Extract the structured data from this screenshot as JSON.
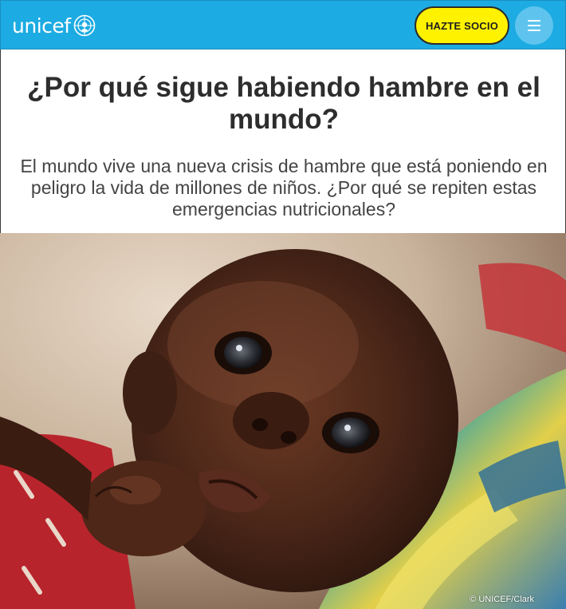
{
  "header": {
    "logo_text": "unicef",
    "logo_emblem": "unicef-globe-emblem-icon",
    "cta_label": "HAZTE SOCIO",
    "menu_icon": "hamburger-menu-icon",
    "brand_color": "#1cabe2",
    "cta_color": "#fff200"
  },
  "article": {
    "title": "¿Por qué sigue habiendo hambre en el mundo?",
    "subtitle": "El mundo vive una nueva crisis de hambre que está poniendo en peligro la vida de millones de niños. ¿Por qué se repiten estas emergencias nutricionales?"
  },
  "hero": {
    "credit": "© UNICEF/Clark"
  }
}
